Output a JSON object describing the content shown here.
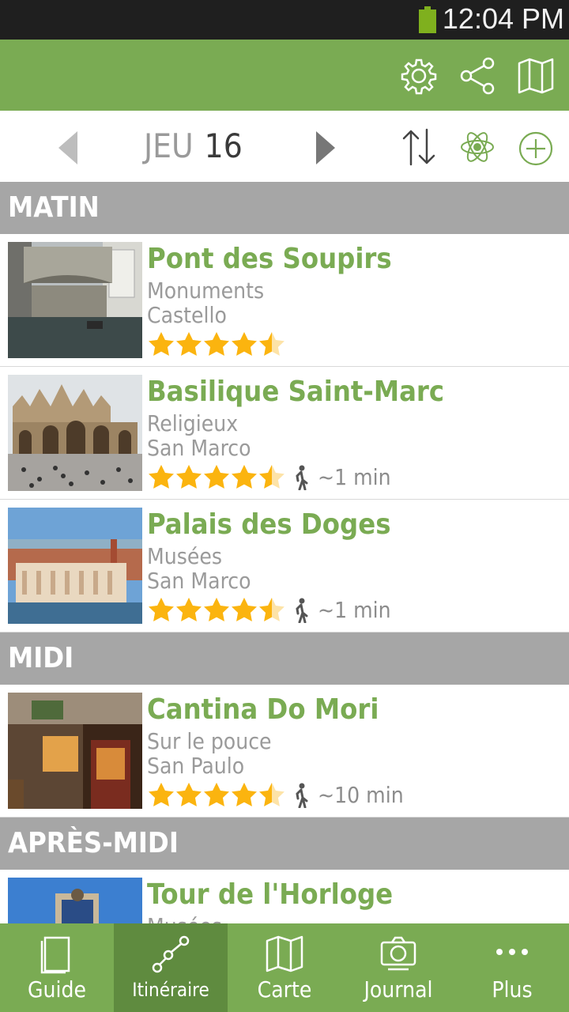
{
  "status": {
    "time": "12:04 PM",
    "battery_icon": "battery-icon"
  },
  "toolbar": {
    "icons": [
      "settings-icon",
      "share-icon",
      "map-icon"
    ]
  },
  "day": {
    "weekday": "JEU",
    "date": "16"
  },
  "colors": {
    "accent": "#7aab53",
    "accent_dark": "#5f8b3f",
    "section_bg": "#a6a6a6",
    "star": "#fbb40f",
    "star_empty": "#fde3a7"
  },
  "sections": [
    {
      "title": "MATIN",
      "items": [
        {
          "name": "Pont des Soupirs",
          "category": "Monuments",
          "area": "Castello",
          "rating": 4.5,
          "walk": ""
        },
        {
          "name": "Basilique Saint-Marc",
          "category": "Religieux",
          "area": "San Marco",
          "rating": 4.5,
          "walk": "~1 min"
        },
        {
          "name": "Palais des Doges",
          "category": "Musées",
          "area": "San Marco",
          "rating": 4.5,
          "walk": "~1 min"
        }
      ]
    },
    {
      "title": "MIDI",
      "items": [
        {
          "name": "Cantina Do Mori",
          "category": "Sur le pouce",
          "area": "San Paulo",
          "rating": 4.5,
          "walk": "~10 min"
        }
      ]
    },
    {
      "title": "APRÈS-MIDI",
      "items": [
        {
          "name": "Tour de l'Horloge",
          "category": "Musées",
          "area": "",
          "rating": 0,
          "walk": ""
        }
      ]
    }
  ],
  "tabs": [
    {
      "label": "Guide",
      "icon": "book-icon",
      "active": false
    },
    {
      "label": "Itinéraire",
      "icon": "route-icon",
      "active": true
    },
    {
      "label": "Carte",
      "icon": "map-icon",
      "active": false
    },
    {
      "label": "Journal",
      "icon": "camera-icon",
      "active": false
    },
    {
      "label": "Plus",
      "icon": "more-icon",
      "active": false
    }
  ]
}
